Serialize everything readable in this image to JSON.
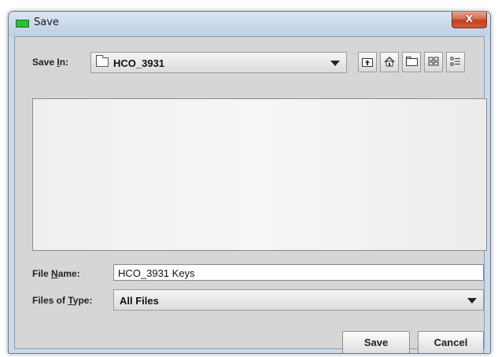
{
  "window": {
    "title": "Save",
    "close_label": "X"
  },
  "save_in": {
    "label_pre": "Save ",
    "label_mnemonic": "I",
    "label_post": "n:",
    "selected": "HCO_3931",
    "toolbar": [
      {
        "name": "up-one-level-icon"
      },
      {
        "name": "home-icon"
      },
      {
        "name": "new-folder-icon"
      },
      {
        "name": "list-view-icon"
      },
      {
        "name": "details-view-icon"
      }
    ]
  },
  "file_name": {
    "label_pre": "File ",
    "label_mnemonic": "N",
    "label_post": "ame:",
    "value": "HCO_3931 Keys"
  },
  "files_of_type": {
    "label_pre": "Files of ",
    "label_mnemonic": "T",
    "label_post": "ype:",
    "selected": "All Files"
  },
  "buttons": {
    "save": "Save",
    "cancel": "Cancel"
  }
}
